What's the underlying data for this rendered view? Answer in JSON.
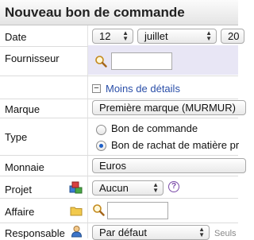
{
  "title": "Nouveau bon de commande",
  "fields": {
    "date": {
      "label": "Date",
      "day": "12",
      "month": "juillet",
      "year": "20"
    },
    "fournisseur": {
      "label": "Fournisseur",
      "value": ""
    },
    "details_toggle": {
      "symbol": "−",
      "label": "Moins de détails"
    },
    "marque": {
      "label": "Marque",
      "value": "Première marque (MURMUR)"
    },
    "type": {
      "label": "Type",
      "options": [
        {
          "label": "Bon de commande",
          "selected": false
        },
        {
          "label": "Bon de rachat de matière pr",
          "selected": true
        }
      ]
    },
    "monnaie": {
      "label": "Monnaie",
      "value": "Euros"
    },
    "projet": {
      "label": "Projet",
      "value": "Aucun",
      "help": "?"
    },
    "affaire": {
      "label": "Affaire",
      "value": ""
    },
    "responsable": {
      "label": "Responsable",
      "value": "Par défaut",
      "hint": "Seuls"
    }
  },
  "icons": {
    "fournisseur_search": "magnifier-icon",
    "projet": "project-boxes-icon",
    "affaire_folder": "folder-icon",
    "affaire_search": "magnifier-icon",
    "responsable": "user-icon",
    "help": "help-icon"
  },
  "colors": {
    "link": "#2a4ea8",
    "help": "#7a4aa8",
    "highlight": "#e8e6f5"
  }
}
